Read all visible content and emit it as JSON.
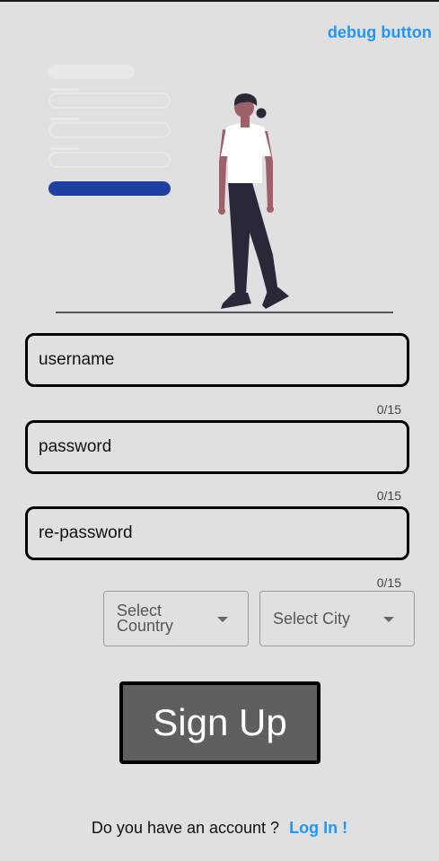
{
  "header": {
    "debug_label": "debug button"
  },
  "form": {
    "username": {
      "placeholder": "username",
      "value": "",
      "counter": "0/15"
    },
    "password": {
      "placeholder": "password",
      "value": "",
      "counter": "0/15"
    },
    "repassword": {
      "placeholder": "re-password",
      "value": "",
      "counter": "0/15"
    }
  },
  "selects": {
    "country": {
      "label_line1": "Select",
      "label_line2": "Country"
    },
    "city": {
      "label": "Select City"
    }
  },
  "actions": {
    "signup_label": "Sign Up"
  },
  "footer": {
    "prompt": "Do you have an account ?",
    "login_label": "Log In !"
  },
  "colors": {
    "background": "#e0e0e0",
    "link": "#2196f3",
    "button": "#5f5f5f",
    "illustration_accent": "#1e40a0",
    "illustration_dark": "#2a2838"
  },
  "icons": {
    "illustration": "person-walking-away-from-form-illustration",
    "dropdown": "chevron-down-icon"
  }
}
